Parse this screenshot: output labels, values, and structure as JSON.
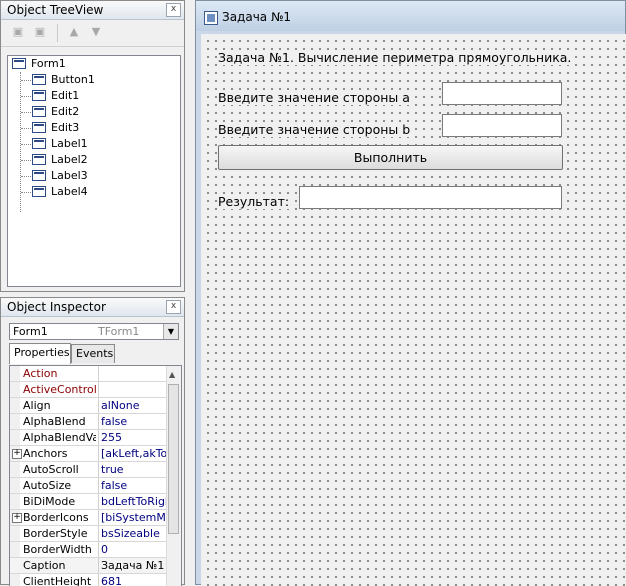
{
  "treeview": {
    "title": "Object TreeView",
    "close": "x",
    "items": [
      "Form1",
      "Button1",
      "Edit1",
      "Edit2",
      "Edit3",
      "Label1",
      "Label2",
      "Label3",
      "Label4"
    ]
  },
  "inspector": {
    "title": "Object Inspector",
    "close": "x",
    "component_name": "Form1",
    "component_type": "TForm1",
    "tabs": [
      "Properties",
      "Events"
    ],
    "properties": [
      {
        "name": "Action",
        "value": ""
      },
      {
        "name": "ActiveControl",
        "value": ""
      },
      {
        "name": "Align",
        "value": "alNone"
      },
      {
        "name": "AlphaBlend",
        "value": "false"
      },
      {
        "name": "AlphaBlendValu",
        "value": "255"
      },
      {
        "name": "Anchors",
        "value": "[akLeft,akTop"
      },
      {
        "name": "AutoScroll",
        "value": "true"
      },
      {
        "name": "AutoSize",
        "value": "false"
      },
      {
        "name": "BiDiMode",
        "value": "bdLeftToRight"
      },
      {
        "name": "BorderIcons",
        "value": "[biSystemMen"
      },
      {
        "name": "BorderStyle",
        "value": "bsSizeable"
      },
      {
        "name": "BorderWidth",
        "value": "0"
      },
      {
        "name": "Caption",
        "value": "Задача №1"
      },
      {
        "name": "ClientHeight",
        "value": "681"
      }
    ]
  },
  "form": {
    "caption": "Задача №1",
    "label1": "Задача №1. Вычисление периметра прямоугольника.",
    "label2": "Введите значение стороны a",
    "label3": "Введите значение стороны b",
    "button1": "Выполнить",
    "label4": "Результат:",
    "edit1": "",
    "edit2": "",
    "edit3": ""
  }
}
